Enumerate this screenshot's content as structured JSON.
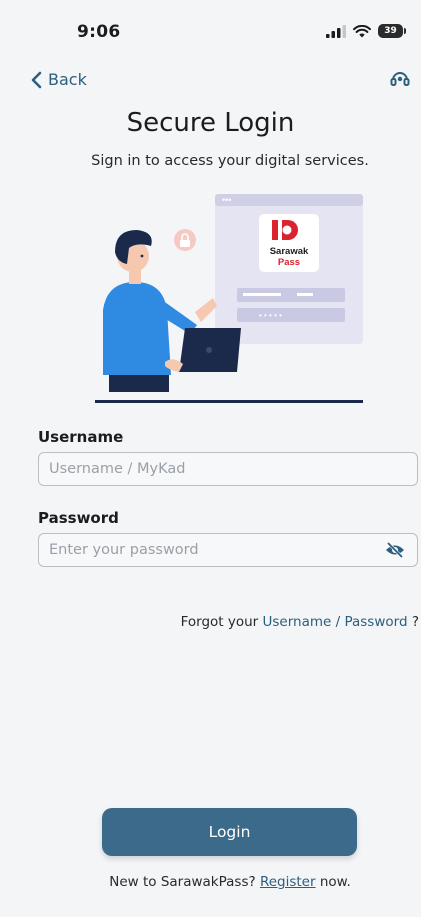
{
  "status_bar": {
    "time": "9:06",
    "battery": "39"
  },
  "nav": {
    "back_label": "Back"
  },
  "header": {
    "title": "Secure Login",
    "subtitle": "Sign in to access your digital services."
  },
  "illustration": {
    "logo_line1": "Sarawak",
    "logo_line2": "Pass",
    "window_dots": "•••",
    "password_dots": "• • • • •"
  },
  "form": {
    "username_label": "Username",
    "username_placeholder": "Username / MyKad",
    "password_label": "Password",
    "password_placeholder": "Enter your password",
    "forgot_prefix": "Forgot your ",
    "forgot_link": "Username / Password",
    "forgot_suffix": " ?"
  },
  "actions": {
    "login_label": "Login",
    "register_prefix": "New to SarawakPass? ",
    "register_link": "Register",
    "register_suffix": " now."
  },
  "colors": {
    "accent": "#3c6a8a",
    "link": "#2d5e7e",
    "logo_red": "#d9232e"
  }
}
